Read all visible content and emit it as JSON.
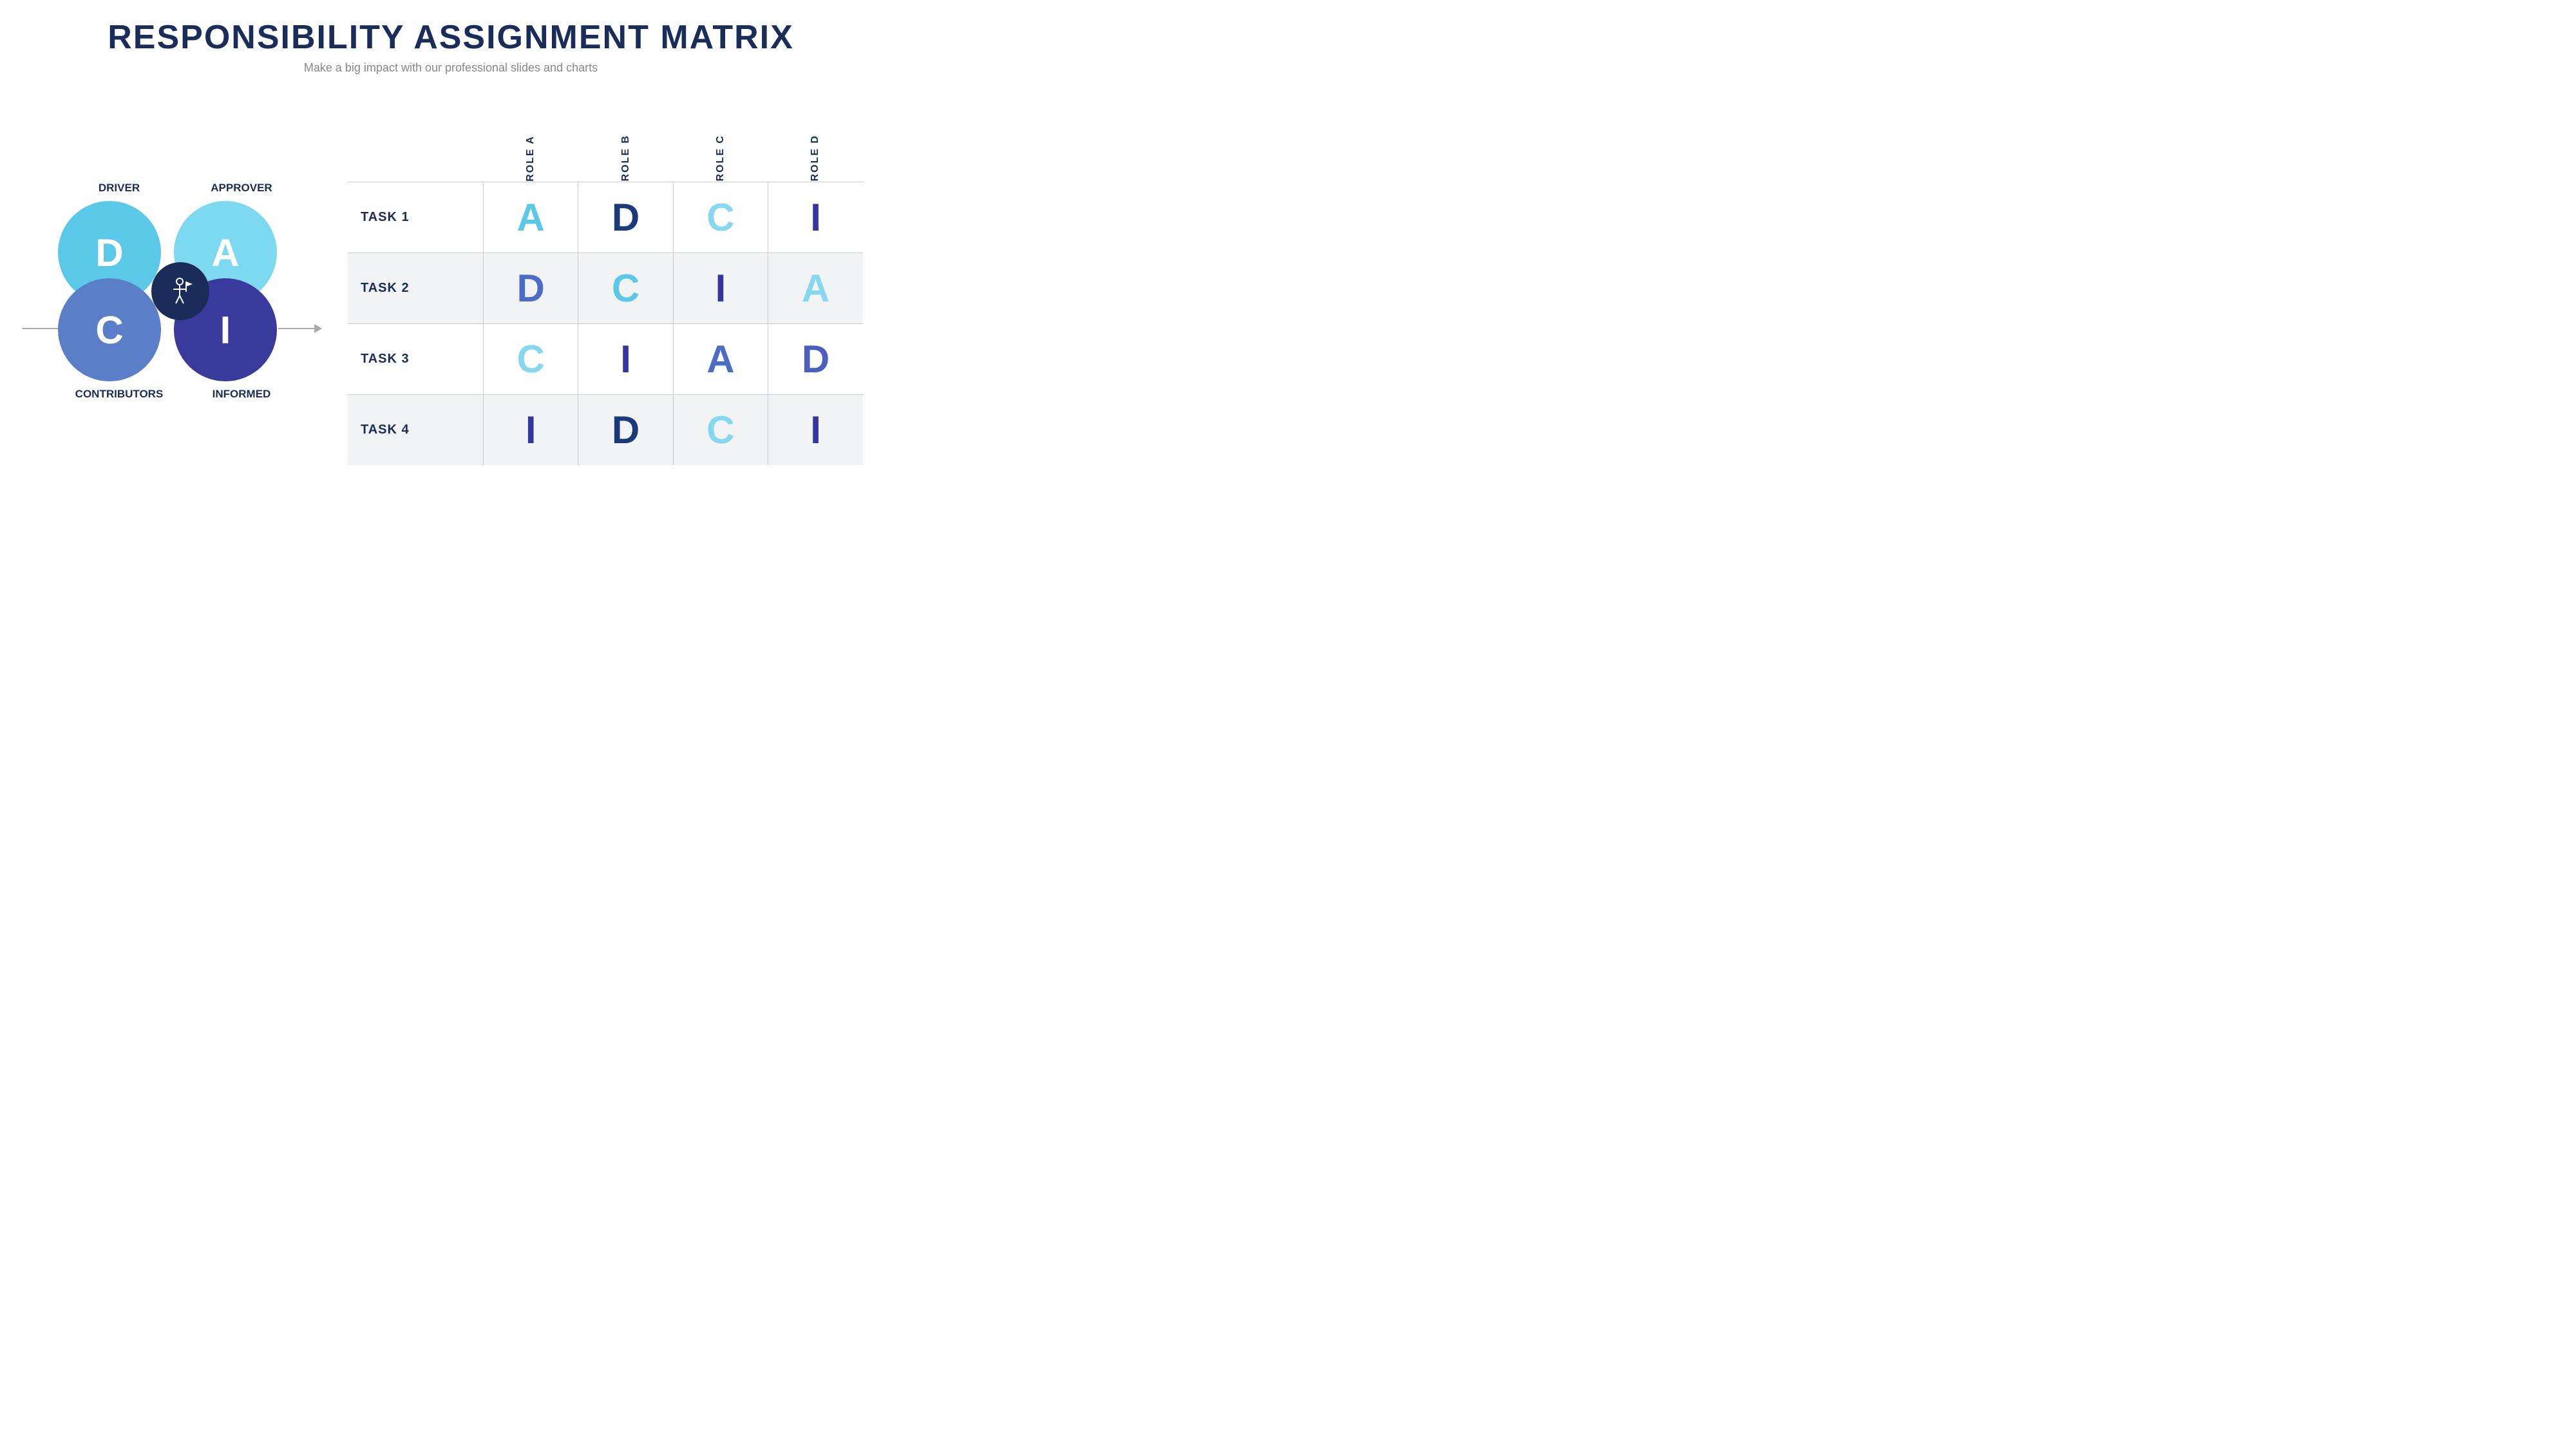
{
  "header": {
    "title": "RESPONSIBILITY ASSIGNMENT MATRIX",
    "subtitle": "Make a big impact with our professional slides and charts"
  },
  "daci": {
    "roles": [
      {
        "id": "driver",
        "label": "DRIVER",
        "letter": "D",
        "color": "#5bc8e8",
        "position": "top-left"
      },
      {
        "id": "approver",
        "label": "APPROVER",
        "letter": "A",
        "color": "#7dd9f0",
        "position": "top-right"
      },
      {
        "id": "contributors",
        "label": "CONTRIBUTORS",
        "letter": "C",
        "color": "#5b7ec8",
        "position": "bottom-left"
      },
      {
        "id": "informed",
        "label": "INFORMED",
        "letter": "I",
        "color": "#3a3a9c",
        "position": "bottom-right"
      }
    ]
  },
  "matrix": {
    "columns": [
      {
        "id": "task-col",
        "label": ""
      },
      {
        "id": "role-a",
        "label": "ROLE A"
      },
      {
        "id": "role-b",
        "label": "ROLE B"
      },
      {
        "id": "role-c",
        "label": "ROLE C"
      },
      {
        "id": "role-d",
        "label": "ROLE D"
      }
    ],
    "rows": [
      {
        "task": "TASK 1",
        "shaded": false,
        "values": [
          {
            "letter": "A",
            "colorClass": "lc-cyan"
          },
          {
            "letter": "D",
            "colorClass": "lc-dark"
          },
          {
            "letter": "C",
            "colorClass": "lc-lightcyan"
          },
          {
            "letter": "I",
            "colorClass": "lc-navy"
          }
        ]
      },
      {
        "task": "TASK 2",
        "shaded": true,
        "values": [
          {
            "letter": "D",
            "colorClass": "lc-blue"
          },
          {
            "letter": "C",
            "colorClass": "lc-cyan"
          },
          {
            "letter": "I",
            "colorClass": "lc-navy"
          },
          {
            "letter": "A",
            "colorClass": "lc-lightcyan"
          }
        ]
      },
      {
        "task": "TASK 3",
        "shaded": false,
        "values": [
          {
            "letter": "C",
            "colorClass": "lc-lightcyan"
          },
          {
            "letter": "I",
            "colorClass": "lc-navy"
          },
          {
            "letter": "A",
            "colorClass": "lc-blue"
          },
          {
            "letter": "D",
            "colorClass": "lc-medblue"
          }
        ]
      },
      {
        "task": "TASK 4",
        "shaded": true,
        "values": [
          {
            "letter": "I",
            "colorClass": "lc-navy"
          },
          {
            "letter": "D",
            "colorClass": "lc-dark"
          },
          {
            "letter": "C",
            "colorClass": "lc-lightcyan"
          },
          {
            "letter": "I",
            "colorClass": "lc-navy"
          }
        ]
      }
    ]
  }
}
